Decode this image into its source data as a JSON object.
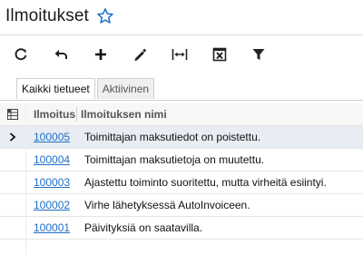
{
  "page": {
    "title": "Ilmoitukset",
    "favorite_icon": "star-outline-icon",
    "accent": "#1f6fc5"
  },
  "toolbar": {
    "buttons": [
      {
        "name": "refresh",
        "icon": "refresh-icon"
      },
      {
        "name": "undo",
        "icon": "undo-icon"
      },
      {
        "name": "add",
        "icon": "plus-icon"
      },
      {
        "name": "edit",
        "icon": "pencil-icon"
      },
      {
        "name": "fit-columns",
        "icon": "fit-width-icon"
      },
      {
        "name": "export",
        "icon": "excel-export-icon"
      },
      {
        "name": "filter",
        "icon": "filter-icon"
      }
    ]
  },
  "tabs": [
    {
      "label": "Kaikki tietueet",
      "active": true
    },
    {
      "label": "Aktiivinen",
      "active": false
    }
  ],
  "grid": {
    "columns": {
      "id": "Ilmoitus",
      "name": "Ilmoituksen nimi"
    },
    "rows": [
      {
        "id": "100005",
        "name": "Toimittajan maksutiedot on poistettu.",
        "selected": true
      },
      {
        "id": "100004",
        "name": "Toimittajan maksutietoja on muutettu.",
        "selected": false
      },
      {
        "id": "100003",
        "name": "Ajastettu toiminto suoritettu, mutta virheitä esiintyi.",
        "selected": false
      },
      {
        "id": "100002",
        "name": "Virhe lähetyksessä AutoInvoiceen.",
        "selected": false
      },
      {
        "id": "100001",
        "name": "Päivityksiä on saatavilla.",
        "selected": false
      }
    ]
  }
}
